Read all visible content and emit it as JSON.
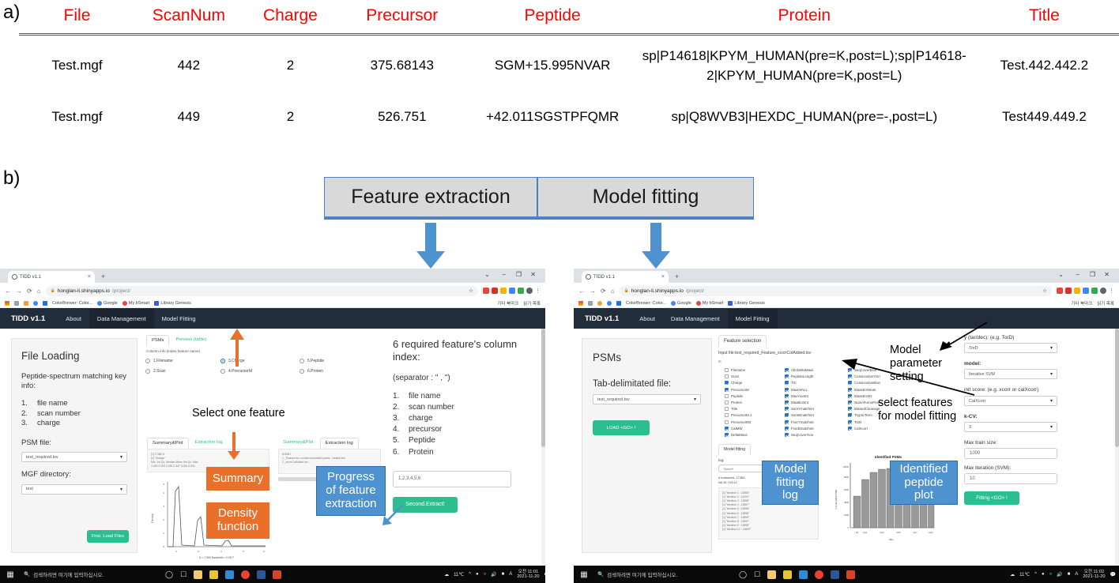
{
  "panels": {
    "a": "a)",
    "b": "b)"
  },
  "table": {
    "headers": [
      "File",
      "ScanNum",
      "Charge",
      "Precursor",
      "Peptide",
      "Protein",
      "Title"
    ],
    "header_color": "#ff0000",
    "rows": [
      {
        "file": "Test.mgf",
        "scannum": "442",
        "charge": "2",
        "precursor": "375.68143",
        "peptide": "SGM+15.995NVAR",
        "protein": "sp|P14618|KPYM_HUMAN(pre=K,post=L);sp|P14618-2|KPYM_HUMAN(pre=K,post=L)",
        "title": "Test.442.442.2"
      },
      {
        "file": "Test.mgf",
        "scannum": "449",
        "charge": "2",
        "precursor": "526.751",
        "peptide": "+42.011SGSTPFQMR",
        "protein": "sp|Q8WVB3|HEXDC_HUMAN(pre=-,post=L)",
        "title": "Test449.449.2"
      }
    ]
  },
  "flow": {
    "boxes": [
      {
        "label": "Feature extraction"
      },
      {
        "label": "Model fitting"
      }
    ],
    "arrow_color": "#4e93d0",
    "box_fill": "#d9d9d9",
    "box_border": "#4f81bd"
  },
  "browser_left": {
    "tab_title": "TIDD v1.1",
    "tab_close": "×",
    "new_tab": "+",
    "window_controls": [
      "⌄",
      "–",
      "❐",
      "✕"
    ],
    "nav_back": "←",
    "nav_forward": "→",
    "nav_reload": "⟳",
    "nav_home": "⌂",
    "url_lock": "🔒",
    "url_host": "honglan-li.shinyapps.io",
    "url_path": "/project/",
    "star": "☆",
    "bookmarks": [
      "ColorBrewer: Color...",
      "Google",
      "My bSmart",
      "Library Genesis"
    ],
    "bookmark_right": [
      "기타 북마크",
      "읽기 목록"
    ],
    "app": {
      "brand": "TIDD v1.1",
      "nav": [
        {
          "label": "About",
          "active": false
        },
        {
          "label": "Data Management",
          "active": true
        },
        {
          "label": "Model Fitting",
          "active": false
        }
      ],
      "sidebar": {
        "heading": "File Loading",
        "subheading": "Peptide-spectrum matching key info:",
        "list": [
          "file name",
          "scan number",
          "charge"
        ],
        "psm_file_label": "PSM file:",
        "psm_file_value": "test_required.tsv",
        "mgf_dir_label": "MGF directory:",
        "mgf_dir_value": "test",
        "load_button": "First. Load Files"
      },
      "content": {
        "tabs": [
          {
            "label": "PSMs",
            "active": true
          },
          {
            "label": "Preview (table)",
            "active": false
          }
        ],
        "column_info_label": "Column info (index,feature name)",
        "radio_options": [
          {
            "label": "1.Filename",
            "selected": false
          },
          {
            "label": "2.Scan",
            "selected": false
          },
          {
            "label": "3.Charge",
            "selected": true
          },
          {
            "label": "4.PrecursorM",
            "selected": false
          },
          {
            "label": "5.Peptide",
            "selected": false
          },
          {
            "label": "6.Protein",
            "selected": false
          }
        ],
        "summary_tabs": [
          {
            "label": "Summary&Plot",
            "active": false
          },
          {
            "label": "Extraction log",
            "active": true
          }
        ],
        "summary_tabs_left": [
          {
            "label": "Summary&Plot",
            "active": true
          },
          {
            "label": "Extraction log",
            "active": false
          }
        ],
        "summary_code": [
          "[1] 17380    6",
          "[1] \"Charge\"",
          "  Min. 1st Qu.  Median    Mean 3rd Qu.    Max.",
          "  2.000   2.000   2.000   2.347   3.000   6.000"
        ],
        "extraction_code": [
          "DONE!",
          "1._Feature.tsv: contain annotated peaks - related fea",
          "2._xcorrColAdded.tsv: ..."
        ],
        "density_plot": {
          "ylabel": "Density",
          "xlabel": "N = 17380   Bandwidth = 0.0677"
        },
        "right_heading": "6 required feature's column index:",
        "separator_note": "(separator : \" , \")",
        "right_list": [
          "file name",
          "scan number",
          "charge",
          "precursor",
          "Peptide",
          "Protein"
        ],
        "index_input_value": "1,2,3,4,5,6",
        "extract_button": "Second.Extract!"
      }
    },
    "annotations": {
      "select_one_feature": "Select one feature",
      "summary": "Summary",
      "density_function": "Density\nfunction",
      "progress": "Progress\nof feature\nextraction"
    }
  },
  "browser_right": {
    "tab_title": "TIDD v1.1",
    "tab_close": "×",
    "new_tab": "+",
    "window_controls": [
      "⌄",
      "–",
      "❐",
      "✕"
    ],
    "nav_back": "←",
    "nav_forward": "→",
    "nav_reload": "⟳",
    "nav_home": "⌂",
    "url_lock": "🔒",
    "url_host": "honglan-li.shinyapps.io",
    "url_path": "/project/",
    "star": "☆",
    "bookmarks": [
      "ColorBrewer: Color...",
      "Google",
      "My bSmart",
      "Library Genesis"
    ],
    "bookmark_right": [
      "기타 북마크",
      "읽기 목록"
    ],
    "app": {
      "brand": "TIDD v1.1",
      "nav": [
        {
          "label": "About",
          "active": false
        },
        {
          "label": "Data Management",
          "active": false
        },
        {
          "label": "Model Fitting",
          "active": true
        }
      ],
      "sidebar": {
        "heading": "PSMs",
        "file_label": "Tab-delimitated file:",
        "file_value": "test_required.tsv",
        "load_button": "LOAD <GO> !"
      },
      "content": {
        "tab_label": "Feature selection",
        "input_file_line": "Input file:test_required_Feature_xcorrColAdded.tsv",
        "x_label": "X:",
        "checkbox_col1": [
          {
            "label": "Filename",
            "checked": false
          },
          {
            "label": "Scan",
            "checked": false
          },
          {
            "label": "Charge",
            "checked": true
          },
          {
            "label": "PrecursorM",
            "checked": true
          },
          {
            "label": "Peptide",
            "checked": false
          },
          {
            "label": "Protein",
            "checked": false
          },
          {
            "label": "Title",
            "checked": false
          },
          {
            "label": "PrecursorM.1",
            "checked": false
          },
          {
            "label": "PrecursorM2",
            "checked": false
          },
          {
            "label": "CalMW",
            "checked": true
          },
          {
            "label": "DeltaMass",
            "checked": true
          }
        ],
        "checkbox_col2": [
          {
            "label": "AbsDeltaMass",
            "checked": true
          },
          {
            "label": "PeptideLength",
            "checked": true
          },
          {
            "label": "TIC",
            "checked": true
          },
          {
            "label": "MaxIntALL",
            "checked": true
          },
          {
            "label": "MaxYionInt",
            "checked": true
          },
          {
            "label": "MaxBionInt",
            "checked": true
          },
          {
            "label": "SumYmatchInt",
            "checked": true
          },
          {
            "label": "SumBmatchInt",
            "checked": true
          },
          {
            "label": "FracYmatchInt",
            "checked": true
          },
          {
            "label": "FracBmatchInt",
            "checked": true
          },
          {
            "label": "SeqCoverYion",
            "checked": true
          }
        ],
        "checkbox_col3": [
          {
            "label": "SeqCoverBion",
            "checked": true
          },
          {
            "label": "ConsecutiveYion",
            "checked": true
          },
          {
            "label": "ConsecutiveBion",
            "checked": true
          },
          {
            "label": "MassErrMean",
            "checked": true
          },
          {
            "label": "MassErrSD",
            "checked": true
          },
          {
            "label": "NumofAnnoPeaks",
            "checked": true
          },
          {
            "label": "MissedCleavage",
            "checked": true
          },
          {
            "label": "TrypticTerm",
            "checked": true
          },
          {
            "label": "TorD",
            "checked": true
          },
          {
            "label": "CalXcorr",
            "checked": true
          }
        ],
        "model_fitting_tab": "Model fitting",
        "log_label": "log:",
        "log_value": "Done!!",
        "log_header": [
          "# instances: 17389",
          "Init ID: 10212"
        ],
        "log_lines": [
          "[1] \"iteration  1 :  12866\"",
          "[1] \"iteration  2 :  13261\"",
          "[1] \"iteration  3 :  13898\"",
          "[1] \"iteration  4 :  13987\"",
          "[1] \"iteration  5 :  13898\"",
          "[1] \"iteration  6 :  13898\"",
          "[1] \"iteration  7 :  13898\"",
          "[1] \"iteration  8 :  13897\"",
          "[1] \"iteration  9 :  13898\"",
          "[1] \"iteration 10 :  13899\""
        ],
        "params": [
          {
            "label": "y (tar/dec): (e.g. TorD)",
            "value": "TorD",
            "type": "select"
          },
          {
            "label": "model:",
            "value": "Iterative SVM",
            "type": "select"
          },
          {
            "label": "init score: (e.g. xcorr or calXcorr)",
            "value": "CalXcorr",
            "type": "select"
          },
          {
            "label": "k-CV:",
            "value": "3",
            "type": "select"
          },
          {
            "label": "Max train size:",
            "value": "1000",
            "type": "input"
          },
          {
            "label": "Max iteration (SVM):",
            "value": "10",
            "type": "input"
          }
        ],
        "fitting_button": "Fitting <GO> !"
      }
    },
    "annotations": {
      "model_parameter_setting": "Model\nparameter\nsetting",
      "select_features": "select features\nfor model fitting",
      "model_fitting_log": "Model\nfitting\nlog",
      "identified_peptide_plot": "Identified\npeptide\nplot"
    }
  },
  "chart_data": {
    "type": "bar",
    "title": "Identified PSMs",
    "xlabel": "#Iter",
    "ylabel": "# of Identified PSMs",
    "categories": [
      "Init",
      "Iter1",
      "Iter2",
      "Iter3",
      "Iter4",
      "Iter5",
      "Iter6",
      "Iter7",
      "Iter8",
      "Iter9"
    ],
    "values": [
      10212,
      12866,
      13261,
      13898,
      13987,
      13898,
      13898,
      13898,
      13897,
      13898
    ],
    "ylim": [
      0,
      14000
    ],
    "grid": false,
    "legend": "none",
    "bar_color": "#9a9a9a"
  },
  "chart_density": {
    "type": "line",
    "title": "",
    "xlabel": "N = 17380   Bandwidth = 0.0677",
    "ylabel": "Density",
    "x": [
      2,
      3,
      4,
      5,
      6
    ],
    "peaks": [
      {
        "x": 2,
        "height": 1.0
      },
      {
        "x": 3,
        "height": 0.27
      },
      {
        "x": 4,
        "height": 0.05
      }
    ]
  },
  "taskbar_left": {
    "start_icon": "windows-icon",
    "search_placeholder": "검색하려면 여기에 입력하십시오.",
    "temperature": "11℃",
    "time": "오전 11:01",
    "date": "2021-11-20"
  },
  "taskbar_right": {
    "start_icon": "windows-icon",
    "search_placeholder": "검색하려면 여기에 입력하십시오.",
    "temperature": "11℃",
    "time": "오전 11:02",
    "date": "2021-11-20"
  }
}
